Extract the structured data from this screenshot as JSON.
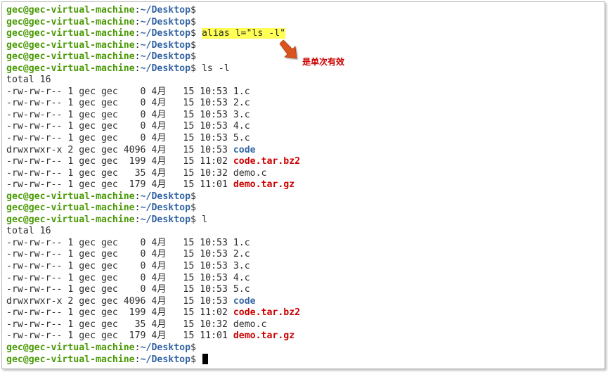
{
  "prompt": {
    "user_host": "gec@gec-virtual-machine",
    "colon": ":",
    "path": "~/Desktop",
    "dollar": "$"
  },
  "colors": {
    "prompt_user": "#4a9a06",
    "prompt_path": "#3465a4",
    "directory": "#3465a4",
    "archive": "#cc0000",
    "highlight": "#ffff55",
    "annotation": "#cc0000"
  },
  "annotation": {
    "text": "是单次有效",
    "icon": "arrow-down-right-icon"
  },
  "lines": [
    {
      "kind": "prompt",
      "cmd": ""
    },
    {
      "kind": "prompt",
      "cmd": ""
    },
    {
      "kind": "prompt",
      "cmd": "alias l=\"ls -l\"",
      "highlight": true
    },
    {
      "kind": "prompt",
      "cmd": ""
    },
    {
      "kind": "prompt",
      "cmd": ""
    },
    {
      "kind": "prompt",
      "cmd": "ls -l"
    },
    {
      "kind": "text",
      "text": "total 16"
    },
    {
      "kind": "file",
      "meta": "-rw-rw-r-- 1 gec gec    0 4月   15 10:53 ",
      "name": "1.c",
      "type": "file"
    },
    {
      "kind": "file",
      "meta": "-rw-rw-r-- 1 gec gec    0 4月   15 10:53 ",
      "name": "2.c",
      "type": "file"
    },
    {
      "kind": "file",
      "meta": "-rw-rw-r-- 1 gec gec    0 4月   15 10:53 ",
      "name": "3.c",
      "type": "file"
    },
    {
      "kind": "file",
      "meta": "-rw-rw-r-- 1 gec gec    0 4月   15 10:53 ",
      "name": "4.c",
      "type": "file"
    },
    {
      "kind": "file",
      "meta": "-rw-rw-r-- 1 gec gec    0 4月   15 10:53 ",
      "name": "5.c",
      "type": "file"
    },
    {
      "kind": "file",
      "meta": "drwxrwxr-x 2 gec gec 4096 4月   15 10:53 ",
      "name": "code",
      "type": "dir"
    },
    {
      "kind": "file",
      "meta": "-rw-rw-r-- 1 gec gec  199 4月   15 11:02 ",
      "name": "code.tar.bz2",
      "type": "archive"
    },
    {
      "kind": "file",
      "meta": "-rw-rw-r-- 1 gec gec   35 4月   15 10:32 ",
      "name": "demo.c",
      "type": "file"
    },
    {
      "kind": "file",
      "meta": "-rw-rw-r-- 1 gec gec  179 4月   15 11:01 ",
      "name": "demo.tar.gz",
      "type": "archive"
    },
    {
      "kind": "prompt",
      "cmd": ""
    },
    {
      "kind": "prompt",
      "cmd": ""
    },
    {
      "kind": "prompt",
      "cmd": "l"
    },
    {
      "kind": "text",
      "text": "total 16"
    },
    {
      "kind": "file",
      "meta": "-rw-rw-r-- 1 gec gec    0 4月   15 10:53 ",
      "name": "1.c",
      "type": "file"
    },
    {
      "kind": "file",
      "meta": "-rw-rw-r-- 1 gec gec    0 4月   15 10:53 ",
      "name": "2.c",
      "type": "file"
    },
    {
      "kind": "file",
      "meta": "-rw-rw-r-- 1 gec gec    0 4月   15 10:53 ",
      "name": "3.c",
      "type": "file"
    },
    {
      "kind": "file",
      "meta": "-rw-rw-r-- 1 gec gec    0 4月   15 10:53 ",
      "name": "4.c",
      "type": "file"
    },
    {
      "kind": "file",
      "meta": "-rw-rw-r-- 1 gec gec    0 4月   15 10:53 ",
      "name": "5.c",
      "type": "file"
    },
    {
      "kind": "file",
      "meta": "drwxrwxr-x 2 gec gec 4096 4月   15 10:53 ",
      "name": "code",
      "type": "dir"
    },
    {
      "kind": "file",
      "meta": "-rw-rw-r-- 1 gec gec  199 4月   15 11:02 ",
      "name": "code.tar.bz2",
      "type": "archive"
    },
    {
      "kind": "file",
      "meta": "-rw-rw-r-- 1 gec gec   35 4月   15 10:32 ",
      "name": "demo.c",
      "type": "file"
    },
    {
      "kind": "file",
      "meta": "-rw-rw-r-- 1 gec gec  179 4月   15 11:01 ",
      "name": "demo.tar.gz",
      "type": "archive"
    },
    {
      "kind": "prompt",
      "cmd": ""
    },
    {
      "kind": "prompt",
      "cmd": "",
      "cursor": true
    }
  ]
}
